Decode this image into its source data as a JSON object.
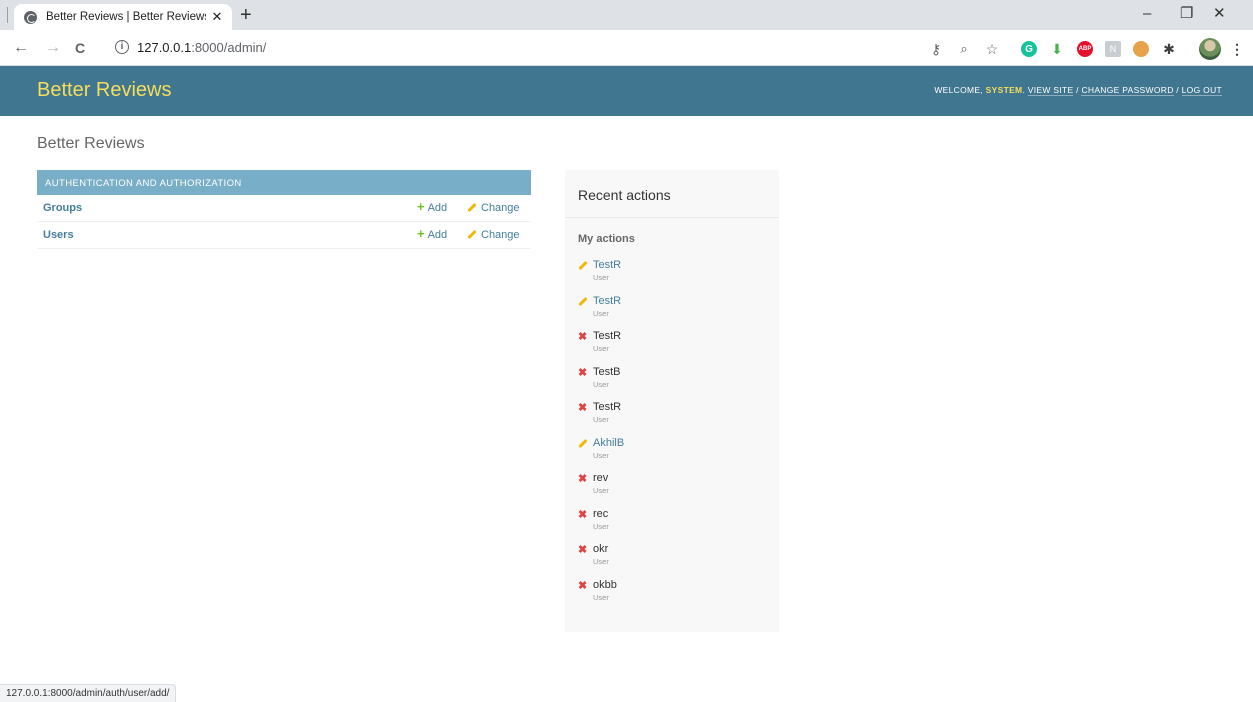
{
  "browser": {
    "tab_title": "Better Reviews | Better Reviews",
    "tab_close": "✕",
    "new_tab": "+",
    "url_host": "127.0.0.1",
    "url_rest": ":8000/admin/",
    "window_controls": {
      "minimize": "–",
      "restore": "❐",
      "close": "✕"
    },
    "nav": {
      "back": "←",
      "forward": "→",
      "reload": "C"
    },
    "toolbar_icons": [
      "key-icon",
      "zoom-icon",
      "bookmark-star-icon",
      "grammarly-icon",
      "download-extension-icon",
      "adblock-icon",
      "extension-icon",
      "cookie-icon",
      "extensions-puzzle-icon",
      "profile-avatar",
      "menu-icon"
    ]
  },
  "header": {
    "branding": "Better Reviews",
    "welcome": "Welcome, ",
    "username": "system",
    "view_site": "View site",
    "change_password": "Change password",
    "log_out": "Log out",
    "sep": " / "
  },
  "content": {
    "title": "Better Reviews",
    "app_module": {
      "caption": "Authentication and Authorization",
      "models": [
        {
          "name": "Groups",
          "add": "Add",
          "change": "Change"
        },
        {
          "name": "Users",
          "add": "Add",
          "change": "Change"
        }
      ]
    }
  },
  "recent_actions": {
    "title": "Recent actions",
    "subtitle": "My actions",
    "items": [
      {
        "name": "TestR",
        "type": "User",
        "action": "change"
      },
      {
        "name": "TestR",
        "type": "User",
        "action": "change"
      },
      {
        "name": "TestR",
        "type": "User",
        "action": "delete"
      },
      {
        "name": "TestB",
        "type": "User",
        "action": "delete"
      },
      {
        "name": "TestR",
        "type": "User",
        "action": "delete"
      },
      {
        "name": "AkhilB",
        "type": "User",
        "action": "change"
      },
      {
        "name": "rev",
        "type": "User",
        "action": "delete"
      },
      {
        "name": "rec",
        "type": "User",
        "action": "delete"
      },
      {
        "name": "okr",
        "type": "User",
        "action": "delete"
      },
      {
        "name": "okbb",
        "type": "User",
        "action": "delete"
      }
    ]
  },
  "status_bar": "127.0.0.1:8000/admin/auth/user/add/",
  "colors": {
    "header_bg": "#417690",
    "branding": "#f5dd5d",
    "caption_bg": "#79aec8",
    "link": "#447e9b",
    "add_green": "#70bf2b",
    "change_yellow": "#efb80b",
    "delete_red": "#dd4646"
  }
}
